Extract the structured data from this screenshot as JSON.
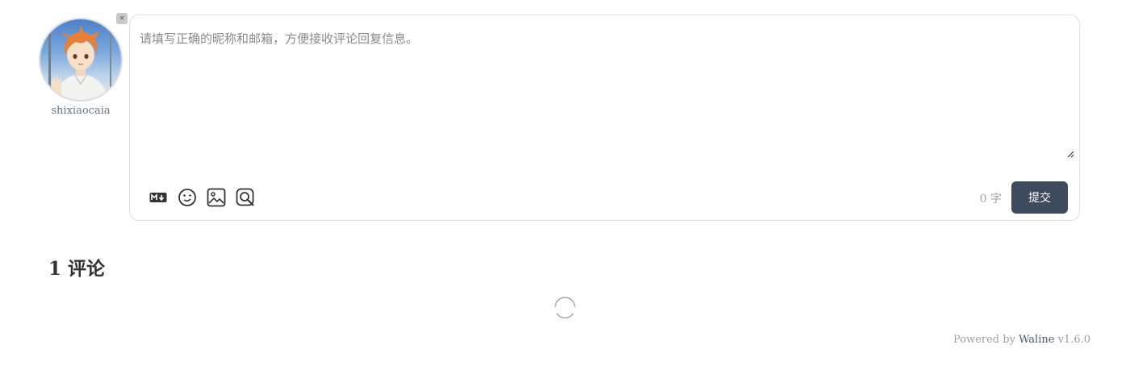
{
  "user": {
    "username": "shixiaocaia",
    "logout_label": "×"
  },
  "editor": {
    "placeholder": "请填写正确的昵称和邮箱，方便接收评论回复信息。",
    "value": "",
    "tools": [
      "markdown-icon",
      "emoji-icon",
      "image-icon",
      "preview-icon"
    ],
    "word_count": "0",
    "word_unit": "字",
    "submit_label": "提交"
  },
  "comments": {
    "count": "1",
    "label": "评论"
  },
  "footer": {
    "powered_by": "Powered by",
    "brand": "Waline",
    "version": "v1.6.0"
  },
  "colors": {
    "submit_bg": "#3e4a5e",
    "border": "#dcdfe4"
  }
}
